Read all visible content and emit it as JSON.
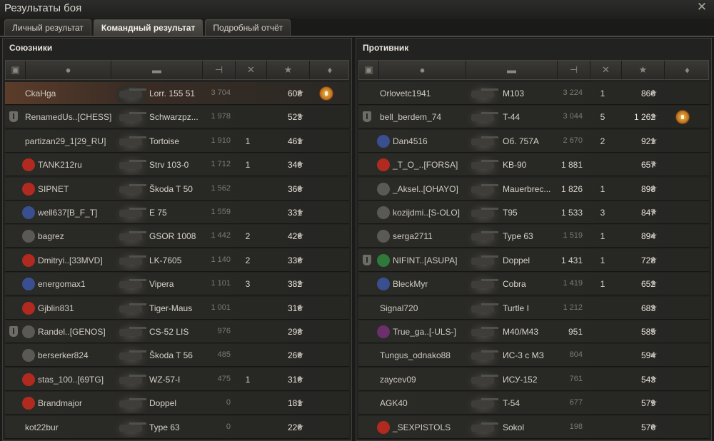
{
  "window": {
    "title": "Результаты боя",
    "close_icon": "close-icon"
  },
  "tabs": [
    {
      "label": "Личный результат",
      "active": false
    },
    {
      "label": "Командный результат",
      "active": true
    },
    {
      "label": "Подробный отчёт",
      "active": false
    }
  ],
  "header_icons": [
    "platoon-icon",
    "player-icon",
    "tank-icon",
    "damage-icon",
    "frags-icon",
    "xp-icon",
    "medal-icon"
  ],
  "allies": {
    "title": "Союзники",
    "rows": [
      {
        "name": "CkaHga",
        "tank": "Lorr. 155 51",
        "damage": "3 704",
        "kills": "",
        "xp": "608",
        "platoon": false,
        "clan": "",
        "medal": true,
        "highlight": true
      },
      {
        "name": "RenamedUs..[CHESS]",
        "tank": "Schwarzpz...",
        "damage": "1 978",
        "kills": "",
        "xp": "523",
        "platoon": true,
        "clan": "",
        "medal": false
      },
      {
        "name": "partizan29_1[29_RU]",
        "tank": "Tortoise",
        "damage": "1 910",
        "kills": "1",
        "xp": "461",
        "platoon": false,
        "clan": "",
        "medal": false
      },
      {
        "name": "TANK212ru",
        "tank": "Strv 103-0",
        "damage": "1 712",
        "kills": "1",
        "xp": "340",
        "platoon": false,
        "clan": "red",
        "medal": false
      },
      {
        "name": "SIPNET",
        "tank": "Škoda T 50",
        "damage": "1 562",
        "kills": "",
        "xp": "360",
        "platoon": false,
        "clan": "red",
        "medal": false
      },
      {
        "name": "well637[B_F_T]",
        "tank": "E 75",
        "damage": "1 559",
        "kills": "",
        "xp": "331",
        "platoon": false,
        "clan": "blue",
        "medal": false
      },
      {
        "name": "bagrez",
        "tank": "GSOR 1008",
        "damage": "1 442",
        "kills": "2",
        "xp": "426",
        "platoon": false,
        "clan": "gray",
        "medal": false
      },
      {
        "name": "Dmitryi..[33MVD]",
        "tank": "LK-7605",
        "damage": "1 140",
        "kills": "2",
        "xp": "336",
        "platoon": false,
        "clan": "red",
        "medal": false
      },
      {
        "name": "energomax1",
        "tank": "Vipera",
        "damage": "1 101",
        "kills": "3",
        "xp": "382",
        "platoon": false,
        "clan": "blue",
        "medal": false
      },
      {
        "name": "Gjblin831",
        "tank": "Tiger-Maus",
        "damage": "1 001",
        "kills": "",
        "xp": "316",
        "platoon": false,
        "clan": "red",
        "medal": false
      },
      {
        "name": "Randel..[GENOS]",
        "tank": "CS-52 LIS",
        "damage": "976",
        "kills": "",
        "xp": "298",
        "platoon": true,
        "clan": "gray",
        "medal": false
      },
      {
        "name": "berserker824",
        "tank": "Škoda T 56",
        "damage": "485",
        "kills": "",
        "xp": "260",
        "platoon": false,
        "clan": "gray",
        "medal": false
      },
      {
        "name": "stas_100..[69TG]",
        "tank": "WZ-57-I",
        "damage": "475",
        "kills": "1",
        "xp": "310",
        "platoon": false,
        "clan": "red",
        "medal": false
      },
      {
        "name": "Brandmajor",
        "tank": "Doppel",
        "damage": "0",
        "kills": "",
        "xp": "181",
        "platoon": false,
        "clan": "red",
        "medal": false
      },
      {
        "name": "kot22bur",
        "tank": "Type 63",
        "damage": "0",
        "kills": "",
        "xp": "220",
        "platoon": false,
        "clan": "",
        "medal": false
      }
    ]
  },
  "enemies": {
    "title": "Противник",
    "rows": [
      {
        "name": "Orlovetc1941",
        "tank": "M103",
        "damage": "3 224",
        "kills": "1",
        "xp": "860",
        "platoon": false,
        "clan": "",
        "medal": false,
        "dmg_bright": false
      },
      {
        "name": "bell_berdem_74",
        "tank": "T-44",
        "damage": "3 044",
        "kills": "5",
        "xp": "1 262",
        "platoon": true,
        "clan": "",
        "medal": true,
        "dmg_bright": false
      },
      {
        "name": "Dan4516",
        "tank": "Об. 757А",
        "damage": "2 670",
        "kills": "2",
        "xp": "921",
        "platoon": false,
        "clan": "blue",
        "medal": false,
        "dmg_bright": false
      },
      {
        "name": "_T_O_..[FORSA]",
        "tank": "KB-90",
        "damage": "1 881",
        "kills": "",
        "xp": "657",
        "platoon": false,
        "clan": "red",
        "medal": false,
        "dmg_bright": true
      },
      {
        "name": "_Aksel..[OHAYO]",
        "tank": "Mauerbrec...",
        "damage": "1 826",
        "kills": "1",
        "xp": "898",
        "platoon": false,
        "clan": "gray",
        "medal": false,
        "dmg_bright": true
      },
      {
        "name": "kozijdmi..[S-OLO]",
        "tank": "T95",
        "damage": "1 533",
        "kills": "3",
        "xp": "847",
        "platoon": false,
        "clan": "gray",
        "medal": false,
        "dmg_bright": true
      },
      {
        "name": "serga2711",
        "tank": "Type 63",
        "damage": "1 519",
        "kills": "1",
        "xp": "894",
        "platoon": false,
        "clan": "gray",
        "medal": false,
        "dmg_bright": false
      },
      {
        "name": "NIFINT..[ASUPA]",
        "tank": "Doppel",
        "damage": "1 431",
        "kills": "1",
        "xp": "728",
        "platoon": true,
        "clan": "green",
        "medal": false,
        "dmg_bright": true
      },
      {
        "name": "BleckMyr",
        "tank": "Cobra",
        "damage": "1 419",
        "kills": "1",
        "xp": "652",
        "platoon": false,
        "clan": "blue",
        "medal": false,
        "dmg_bright": false
      },
      {
        "name": "Signal720",
        "tank": "Turtle I",
        "damage": "1 212",
        "kills": "",
        "xp": "683",
        "platoon": false,
        "clan": "",
        "medal": false,
        "dmg_bright": false
      },
      {
        "name": "True_ga..[-ULS-]",
        "tank": "M40/M43",
        "damage": "951",
        "kills": "",
        "xp": "585",
        "platoon": false,
        "clan": "purple",
        "medal": false,
        "dmg_bright": true
      },
      {
        "name": "Tungus_odnako88",
        "tank": "ИС-3 с МЗ",
        "damage": "804",
        "kills": "",
        "xp": "594",
        "platoon": false,
        "clan": "",
        "medal": false,
        "dmg_bright": false
      },
      {
        "name": "zaycev09",
        "tank": "ИСУ-152",
        "damage": "761",
        "kills": "",
        "xp": "543",
        "platoon": false,
        "clan": "",
        "medal": false,
        "dmg_bright": false
      },
      {
        "name": "AGK40",
        "tank": "T-54",
        "damage": "677",
        "kills": "",
        "xp": "579",
        "platoon": false,
        "clan": "",
        "medal": false,
        "dmg_bright": false
      },
      {
        "name": "_SEXPISTOLS",
        "tank": "Sokol",
        "damage": "198",
        "kills": "",
        "xp": "570",
        "platoon": false,
        "clan": "red",
        "medal": false,
        "dmg_bright": false
      }
    ]
  },
  "colors": {
    "highlight": "#5c3c2a",
    "clan_red": "#b02a20",
    "clan_blue": "#3a4f8f",
    "clan_gray": "#5a5955",
    "clan_green": "#2f7a3a",
    "clan_purple": "#6b2f6b"
  }
}
